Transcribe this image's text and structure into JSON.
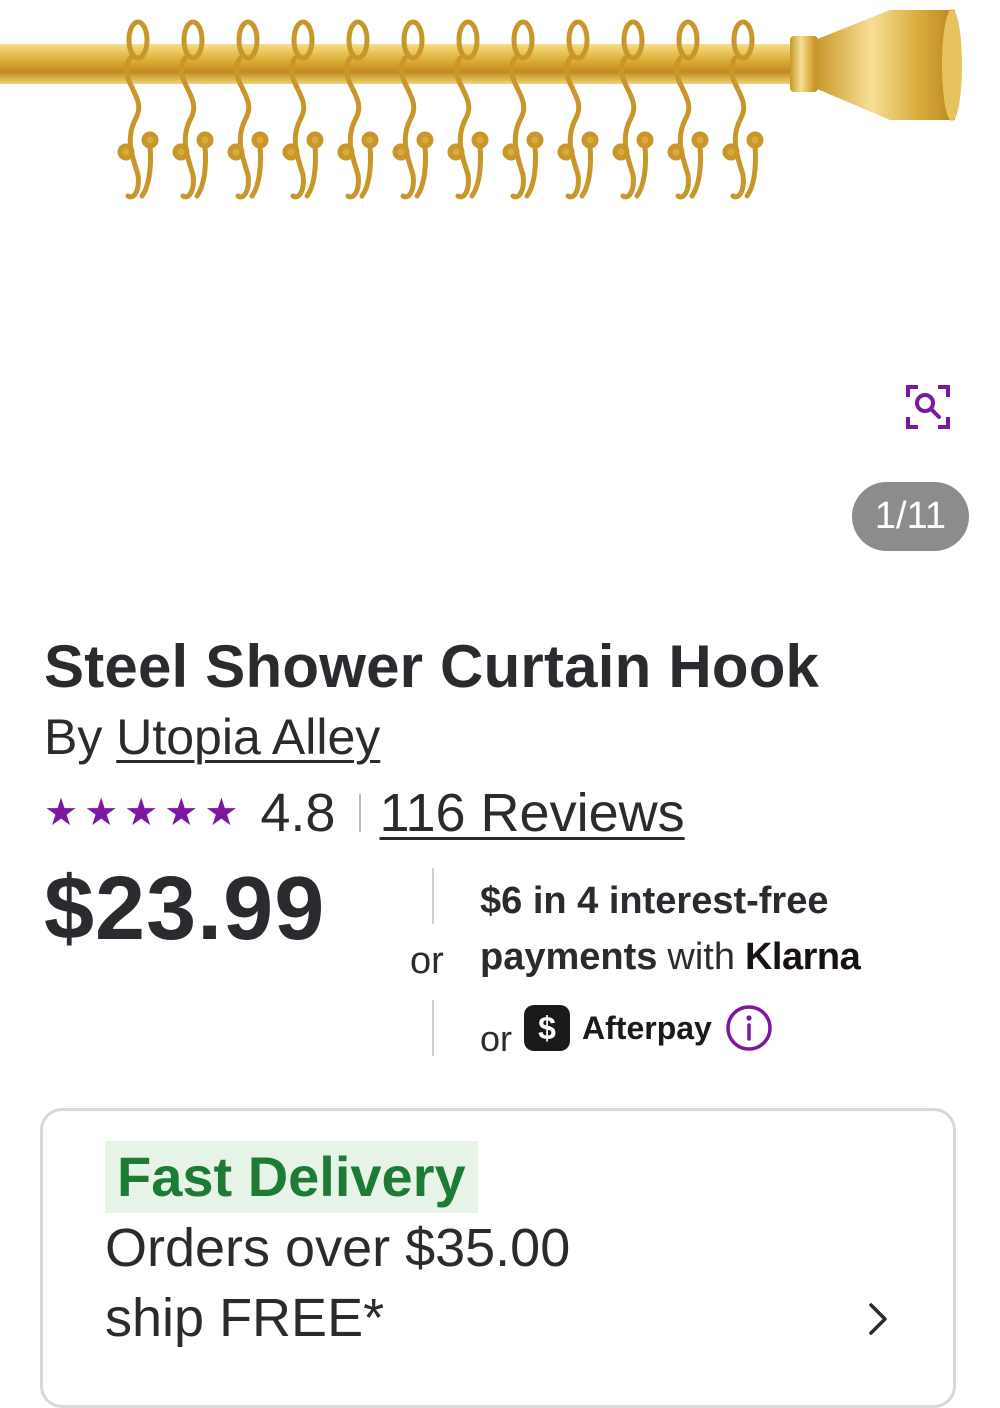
{
  "gallery": {
    "counter": "1/11"
  },
  "product": {
    "title": "Steel Shower Curtain Hook",
    "by_prefix": "By ",
    "brand": "Utopia Alley",
    "rating": "4.8",
    "rating_stars": 5,
    "reviews_label": "116 Reviews",
    "price": "$23.99"
  },
  "payments": {
    "or_label": "or",
    "installments_line": "$6 in 4 interest-free",
    "payments_word": "payments",
    "with_word": "with",
    "klarna_label": "Klarna",
    "or_label_2": "or",
    "cashapp_symbol": "$",
    "afterpay_label": "Afterpay"
  },
  "delivery": {
    "badge": "Fast Delivery",
    "line1": "Orders over $35.00",
    "line2": "ship FREE*"
  },
  "colors": {
    "accent_purple": "#7b189f",
    "delivery_green": "#1e7b36",
    "delivery_bg": "#e6f3e6",
    "text": "#2b2a2e",
    "gold": "#d4a52b"
  },
  "icons": [
    "zoom-search-icon",
    "star-icon",
    "info-icon",
    "chevron-right-icon",
    "cashapp-icon"
  ]
}
